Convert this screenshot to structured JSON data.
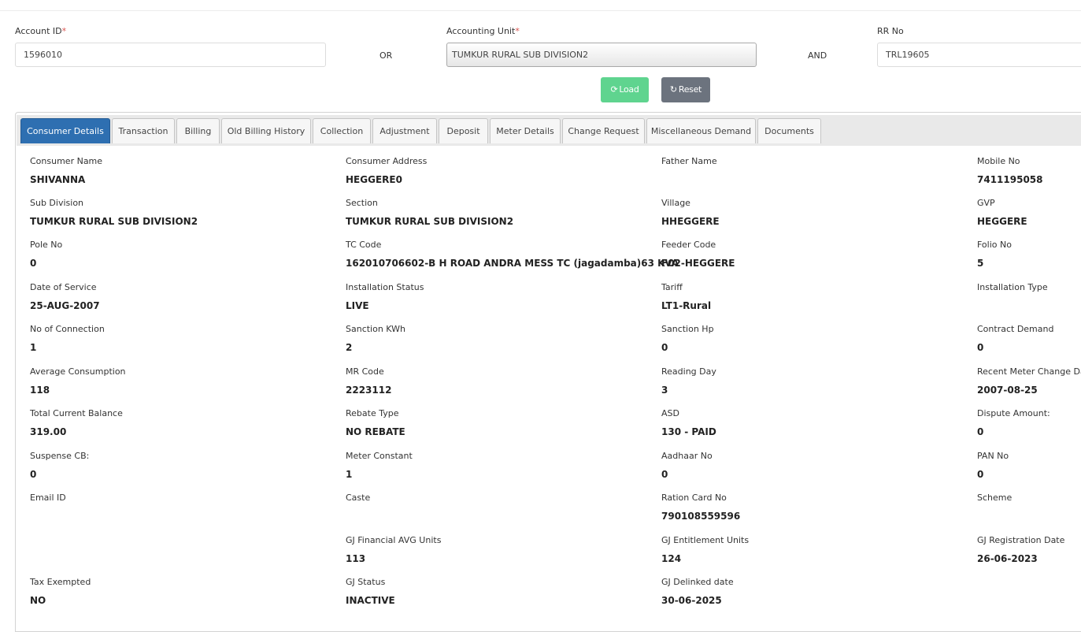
{
  "form": {
    "account_id_label": "Account ID",
    "account_id_value": "1596010",
    "or_text": "OR",
    "accounting_unit_label": "Accounting Unit",
    "accounting_unit_value": "TUMKUR RURAL SUB DIVISION2",
    "and_text": "AND",
    "rr_no_label": "RR No",
    "rr_no_value": "TRL19605",
    "required_mark": "*",
    "load_label": "Load",
    "reset_label": "Reset"
  },
  "tabs": [
    {
      "label": "Consumer Details",
      "active": true
    },
    {
      "label": "Transaction"
    },
    {
      "label": "Billing"
    },
    {
      "label": "Old Billing History"
    },
    {
      "label": "Collection"
    },
    {
      "label": "Adjustment"
    },
    {
      "label": "Deposit"
    },
    {
      "label": "Meter Details"
    },
    {
      "label": "Change Request"
    },
    {
      "label": "Miscellaneous Demand"
    },
    {
      "label": "Documents"
    }
  ],
  "details": [
    [
      {
        "label": "Consumer Name",
        "value": "SHIVANNA"
      },
      {
        "label": "Consumer Address",
        "value": "HEGGERE0"
      },
      {
        "label": "Father Name",
        "value": ""
      },
      {
        "label": "Mobile No",
        "value": "7411195058"
      }
    ],
    [
      {
        "label": "Sub Division",
        "value": "TUMKUR RURAL SUB DIVISION2"
      },
      {
        "label": "Section",
        "value": "TUMKUR RURAL SUB DIVISION2"
      },
      {
        "label": "Village",
        "value": "HHEGGERE"
      },
      {
        "label": "GVP",
        "value": "HEGGERE"
      }
    ],
    [
      {
        "label": "Pole No",
        "value": "0"
      },
      {
        "label": "TC Code",
        "value": "162010706602-B H ROAD ANDRA MESS TC (jagadamba)63 KVA"
      },
      {
        "label": "Feeder Code",
        "value": "F02-HEGGERE"
      },
      {
        "label": "Folio No",
        "value": "5"
      }
    ],
    [
      {
        "label": "Date of Service",
        "value": "25-AUG-2007"
      },
      {
        "label": "Installation Status",
        "value": "LIVE"
      },
      {
        "label": "Tariff",
        "value": "LT1-Rural"
      },
      {
        "label": "Installation Type",
        "value": ""
      }
    ],
    [
      {
        "label": "No of Connection",
        "value": "1"
      },
      {
        "label": "Sanction KWh",
        "value": "2"
      },
      {
        "label": "Sanction Hp",
        "value": "0"
      },
      {
        "label": "Contract Demand",
        "value": "0"
      }
    ],
    [
      {
        "label": "Average Consumption",
        "value": "118"
      },
      {
        "label": "MR Code",
        "value": "2223112"
      },
      {
        "label": "Reading Day",
        "value": "3"
      },
      {
        "label": "Recent Meter Change Date",
        "value": "2007-08-25"
      }
    ],
    [
      {
        "label": "Total Current Balance",
        "value": "319.00"
      },
      {
        "label": "Rebate Type",
        "value": "NO REBATE"
      },
      {
        "label": "ASD",
        "value": "130 - PAID"
      },
      {
        "label": "Dispute Amount:",
        "value": "0"
      }
    ],
    [
      {
        "label": "Suspense CB:",
        "value": "0"
      },
      {
        "label": "Meter Constant",
        "value": "1"
      },
      {
        "label": "Aadhaar No",
        "value": "0"
      },
      {
        "label": "PAN No",
        "value": "0"
      }
    ],
    [
      {
        "label": "Email ID",
        "value": ""
      },
      {
        "label": "Caste",
        "value": ""
      },
      {
        "label": "Ration Card No",
        "value": "790108559596"
      },
      {
        "label": "Scheme",
        "value": ""
      }
    ],
    [
      {
        "label": "",
        "value": ""
      },
      {
        "label": "GJ Financial AVG Units",
        "value": "113"
      },
      {
        "label": "GJ Entitlement Units",
        "value": "124"
      },
      {
        "label": "GJ Registration Date",
        "value": "26-06-2023"
      }
    ],
    [
      {
        "label": "Tax Exempted",
        "value": "NO"
      },
      {
        "label": "GJ Status",
        "value": "INACTIVE"
      },
      {
        "label": "GJ Delinked date",
        "value": "30-06-2025"
      },
      {
        "label": "",
        "value": ""
      }
    ]
  ],
  "colors": {
    "active_tab": "#2e6fb1",
    "load_button": "#5fd48f",
    "reset_button": "#6c737e",
    "required": "#d9534f"
  }
}
